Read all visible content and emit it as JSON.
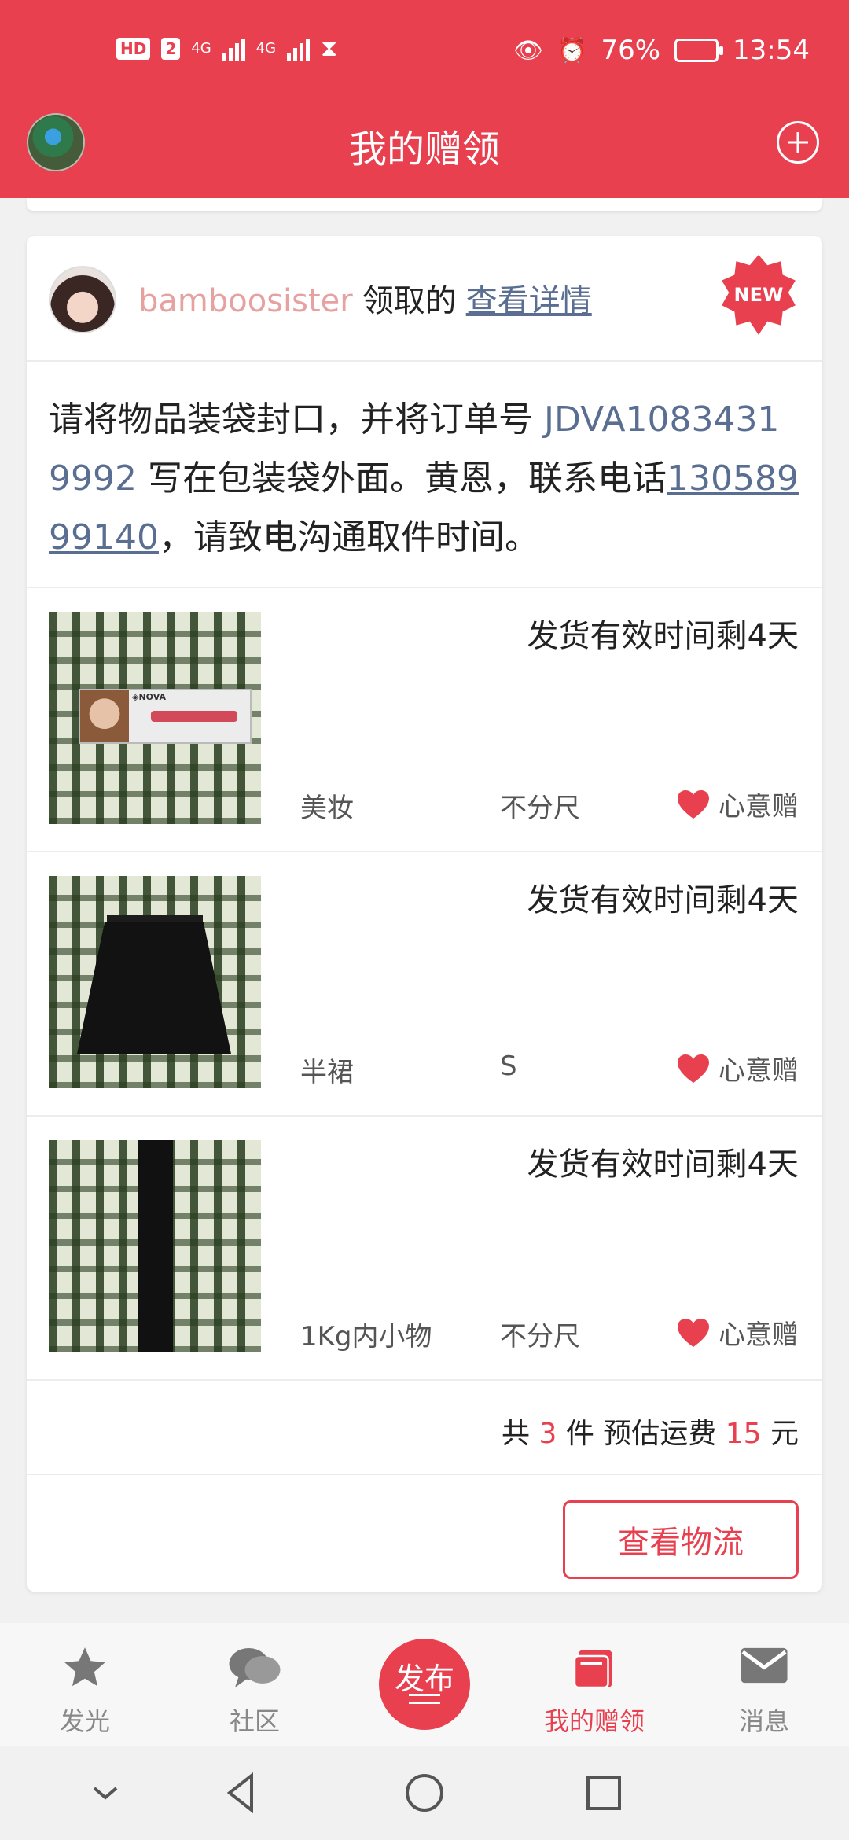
{
  "status_bar": {
    "hd": "HD",
    "sim": "2",
    "net1": "4G",
    "net2": "4G",
    "battery": "76%",
    "time": "13:54"
  },
  "header": {
    "title": "我的赠领"
  },
  "card": {
    "username": "bamboosister",
    "action": "领取的",
    "detail_link": "查看详情",
    "new_badge": "NEW",
    "notice": {
      "part1": "请将物品装袋封口，并将订单号 ",
      "order_no": "JDVA10834319992",
      "part2": " 写在包装袋外面。黄恩，联系电话",
      "phone": "13058999140",
      "part3": "，请致电沟通取件时间。"
    },
    "items": [
      {
        "deadline": "发货有效时间剩4天",
        "category": "美妆",
        "size": "不分尺",
        "gift_type": "心意赠",
        "image": "curling-iron-box"
      },
      {
        "deadline": "发货有效时间剩4天",
        "category": "半裙",
        "size": "S",
        "gift_type": "心意赠",
        "image": "black-pleated-skirt"
      },
      {
        "deadline": "发货有效时间剩4天",
        "category": "1Kg内小物",
        "size": "不分尺",
        "gift_type": "心意赠",
        "image": "black-strap"
      }
    ],
    "summary": {
      "prefix": "共",
      "count": "3",
      "mid": "件 预估运费",
      "fee": "15",
      "suffix": "元"
    },
    "logistics_button": "查看物流"
  },
  "tabbar": {
    "tabs": [
      {
        "label": "发光",
        "icon": "star-icon"
      },
      {
        "label": "社区",
        "icon": "chat-bubble-icon"
      },
      {
        "label": "发布",
        "icon": "publish-icon"
      },
      {
        "label": "我的赠领",
        "icon": "book-icon",
        "active": true
      },
      {
        "label": "消息",
        "icon": "mail-icon"
      }
    ]
  },
  "colors": {
    "brand": "#e8404f",
    "link": "#5a6e92",
    "username": "#e6a1a1"
  }
}
